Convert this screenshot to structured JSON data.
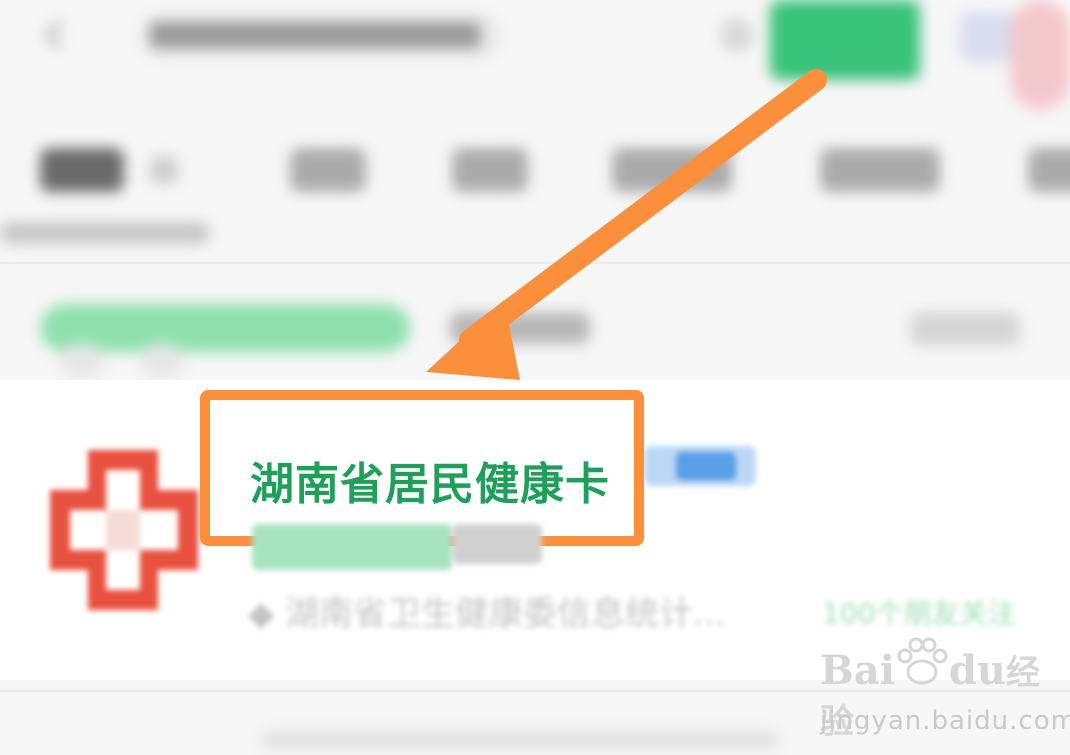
{
  "result": {
    "title": "湖南省居民健康卡",
    "subtitle": "◆ 湖南省卫生健康委信息统计...",
    "followers": "100个朋友关注"
  },
  "watermark": {
    "brand_a": "Bai",
    "brand_b": "du",
    "brand_c": "经验",
    "url": "jingyan.baidu.com"
  },
  "colors": {
    "highlight_box": "#fb8f3b",
    "arrow": "#fb8f3b",
    "title_green": "#1ea05a",
    "search_button": "#39c27a"
  },
  "icons": {
    "back": "back-arrow-icon",
    "app": "health-card-cross-icon",
    "annotation": "pointer-arrow-icon"
  }
}
